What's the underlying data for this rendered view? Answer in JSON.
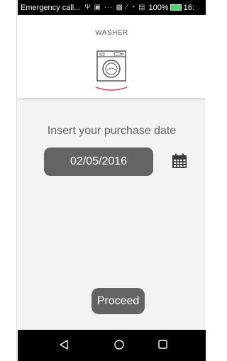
{
  "status_bar": {
    "carrier": "Emergency call...",
    "icons": "Ψ ▣ ···  ▩ ∕ ◔ ▤",
    "battery_pct": "100%",
    "time": "16:"
  },
  "header": {
    "device_title": "WASHER",
    "accent_color": "#e0455a"
  },
  "main": {
    "prompt": "Insert your purchase date",
    "date_value": "02/05/2016"
  },
  "actions": {
    "proceed_label": "Proceed"
  },
  "nav_bar": {
    "back": "back-icon",
    "home": "home-icon",
    "recents": "recents-icon"
  }
}
